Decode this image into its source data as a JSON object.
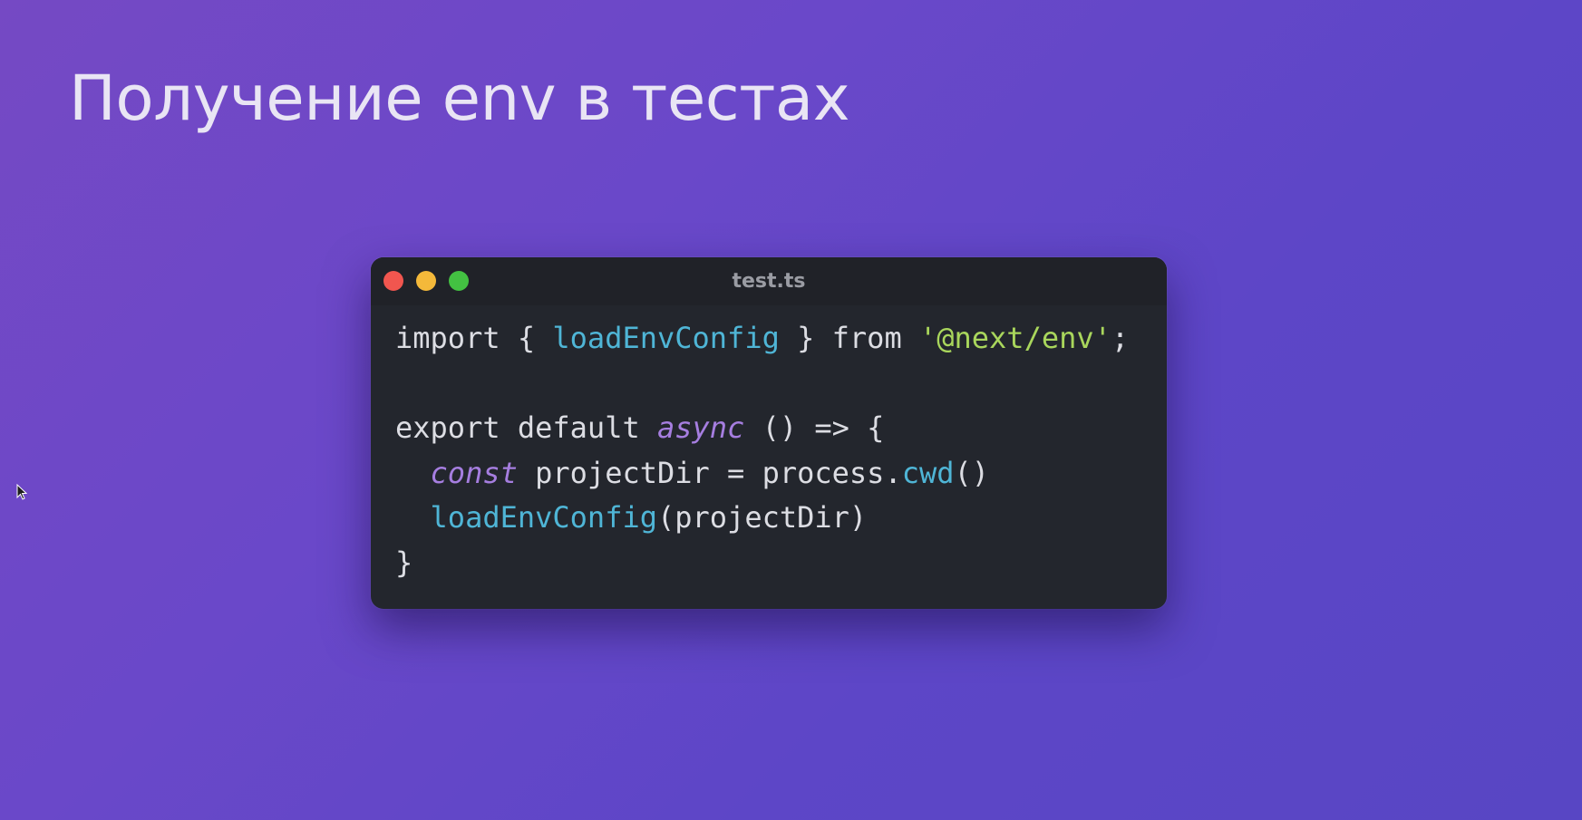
{
  "slide": {
    "title": "Получение env в тестах"
  },
  "code_window": {
    "title": "test.ts",
    "window_controls": [
      "close",
      "minimize",
      "maximize"
    ],
    "lines": [
      [
        {
          "t": "import { ",
          "c": "plain"
        },
        {
          "t": "loadEnvConfig",
          "c": "id"
        },
        {
          "t": " } from ",
          "c": "plain"
        },
        {
          "t": "'@next/env'",
          "c": "str"
        },
        {
          "t": ";",
          "c": "plain"
        }
      ],
      [],
      [
        {
          "t": "export default ",
          "c": "plain"
        },
        {
          "t": "async",
          "c": "kw-it"
        },
        {
          "t": " () => {",
          "c": "plain"
        }
      ],
      [
        {
          "t": "  ",
          "c": "plain"
        },
        {
          "t": "const",
          "c": "kw-it"
        },
        {
          "t": " projectDir = process.",
          "c": "plain"
        },
        {
          "t": "cwd",
          "c": "id"
        },
        {
          "t": "()",
          "c": "plain"
        }
      ],
      [
        {
          "t": "  ",
          "c": "plain"
        },
        {
          "t": "loadEnvConfig",
          "c": "id"
        },
        {
          "t": "(projectDir)",
          "c": "plain"
        }
      ],
      [
        {
          "t": "}",
          "c": "plain"
        }
      ]
    ]
  },
  "colors": {
    "background_start": "#7549c4",
    "background_end": "#5846c4",
    "editor_background": "#23262d",
    "identifier": "#4fb5d6",
    "string": "#a9d65c",
    "keyword_italic": "#a67ee0",
    "close": "#f1564f",
    "minimize": "#f4b93a",
    "maximize": "#43c142"
  },
  "icons": {
    "cursor": "mouse-pointer-icon"
  }
}
